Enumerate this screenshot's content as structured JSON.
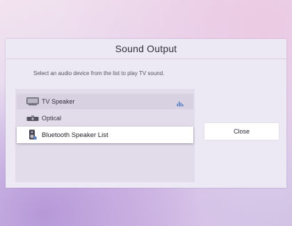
{
  "dialog": {
    "title": "Sound Output",
    "instruction": "Select an audio device from the list to play TV sound."
  },
  "devices": [
    {
      "label": "TV Speaker",
      "icon": "tv-speaker-icon",
      "active": true
    },
    {
      "label": "Optical",
      "icon": "optical-icon",
      "active": false
    },
    {
      "label": "Bluetooth Speaker List",
      "icon": "bluetooth-speaker-icon",
      "focused": true
    }
  ],
  "actions": {
    "close_label": "Close"
  },
  "colors": {
    "accent": "#5b7fc4",
    "focus_background": "#ffffff"
  }
}
